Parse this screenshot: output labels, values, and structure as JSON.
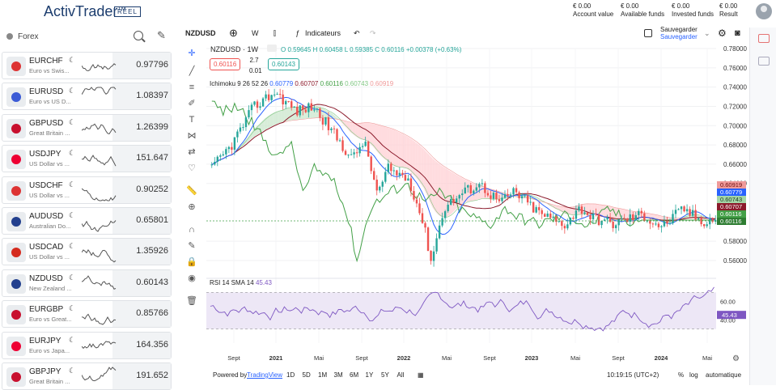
{
  "header": {
    "logo": "ActivTrader",
    "logo_tm": "TM",
    "badge": "RÉEL",
    "stats": [
      {
        "value": "€ 0.00",
        "label": "Account value"
      },
      {
        "value": "€ 0.00",
        "label": "Available funds"
      },
      {
        "value": "€ 0.00",
        "label": "Invested funds"
      },
      {
        "value": "€ 0.00",
        "label": "Result"
      }
    ]
  },
  "sidebar": {
    "title": "Forex",
    "items": [
      {
        "symbol": "EURCHF",
        "desc": "Euro vs Swis...",
        "price": "0.97796",
        "flag_color": "#d33"
      },
      {
        "symbol": "EURUSD",
        "desc": "Euro vs US D...",
        "price": "1.08397",
        "flag_color": "#3b5bd6"
      },
      {
        "symbol": "GBPUSD",
        "desc": "Great Britain ...",
        "price": "1.26399",
        "flag_color": "#c8102e"
      },
      {
        "symbol": "USDJPY",
        "desc": "US Dollar vs ...",
        "price": "151.647",
        "flag_color": "#e03"
      },
      {
        "symbol": "USDCHF",
        "desc": "US Dollar vs ...",
        "price": "0.90252",
        "flag_color": "#d33"
      },
      {
        "symbol": "AUDUSD",
        "desc": "Australian Do...",
        "price": "0.65801",
        "flag_color": "#23408e"
      },
      {
        "symbol": "USDCAD",
        "desc": "US Dollar vs ...",
        "price": "1.35926",
        "flag_color": "#d52b1e"
      },
      {
        "symbol": "NZDUSD",
        "desc": "New Zealand ...",
        "price": "0.60143",
        "flag_color": "#23408e"
      },
      {
        "symbol": "EURGBP",
        "desc": "Euro vs Great...",
        "price": "0.85766",
        "flag_color": "#c8102e"
      },
      {
        "symbol": "EURJPY",
        "desc": "Euro vs Japa...",
        "price": "164.356",
        "flag_color": "#e03"
      },
      {
        "symbol": "GBPJPY",
        "desc": "Great Britain ...",
        "price": "191.652",
        "flag_color": "#c8102e"
      }
    ]
  },
  "toolbar": {
    "symbol": "NZDUSD",
    "interval": "W",
    "indicators": "Indicateurs",
    "save": "Sauvegarder",
    "save_sub": "Sauvegarder"
  },
  "legend": {
    "title": "NZDUSD · 1W",
    "ohlc_o": "O 0.59645",
    "ohlc_h": "H 0.60458",
    "ohlc_l": "L 0.59385",
    "ohlc_c": "C 0.60116",
    "change": "+0.00378 (+0.63%)",
    "bid": "0.60116",
    "spread": "2.7",
    "spread2": "0.01",
    "ask": "0.60143",
    "ichimoku_label": "Ichimoku 9 26 52 26",
    "ichimoku_values": [
      {
        "v": "0.60779",
        "color": "#2962ff"
      },
      {
        "v": "0.60707",
        "color": "#8b1a2b"
      },
      {
        "v": "0.60116",
        "color": "#43a047"
      },
      {
        "v": "0.60743",
        "color": "#81c784"
      },
      {
        "v": "0.60919",
        "color": "#ef9a9a"
      }
    ],
    "rsi_label": "RSI 14 SMA 14",
    "rsi_value": "45.43"
  },
  "price_axis": {
    "ticks": [
      "0.78000",
      "0.76000",
      "0.74000",
      "0.72000",
      "0.70000",
      "0.68000",
      "0.66000",
      "0.64000",
      "0.58000",
      "0.56000"
    ],
    "labels": [
      {
        "v": "0.60919",
        "bg": "#ef9a9a",
        "fg": "#6d0d0d"
      },
      {
        "v": "0.60779",
        "bg": "#2962ff",
        "fg": "#ffffff"
      },
      {
        "v": "0.60743",
        "bg": "#a5d6a7",
        "fg": "#1b3d1d"
      },
      {
        "v": "0.60707",
        "bg": "#8b1a2b",
        "fg": "#ffffff"
      },
      {
        "v": "0.60116",
        "bg": "#43a047",
        "fg": "#ffffff"
      },
      {
        "v": "0.60116",
        "bg": "#2e7d32",
        "fg": "#ffffff"
      }
    ]
  },
  "rsi_axis": {
    "ticks": [
      "60.00",
      "40.00"
    ],
    "current": "45.43"
  },
  "time_axis": [
    "Sept",
    "2021",
    "Mai",
    "Sept",
    "2022",
    "Mai",
    "Sept",
    "2023",
    "Mai",
    "Sept",
    "2024",
    "Mai"
  ],
  "bottom": {
    "powered": "Powered by",
    "powered_link": "TradingView",
    "ranges": [
      "1D",
      "5D",
      "1M",
      "3M",
      "6M",
      "1Y",
      "5Y",
      "All"
    ],
    "clock": "10:19:15 (UTC+2)",
    "pct": "%",
    "log": "log",
    "auto": "automatique"
  },
  "colors": {
    "up": "#26a69a",
    "down": "#ef5350",
    "rsi": "#7e57c2",
    "accent": "#2962ff"
  }
}
